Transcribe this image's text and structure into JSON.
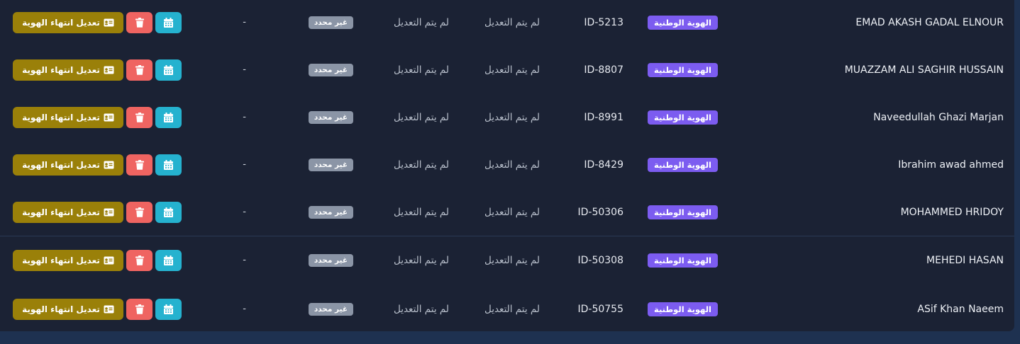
{
  "columns_text": {
    "id_type": "الهوية الوطنية",
    "status_not_modified": "لم يتم التعديل",
    "undefined": "غير محدد",
    "dash": "-",
    "edit_expiry": "تعديل انتهاء الهوية"
  },
  "icons": {
    "edit": "id-card-icon",
    "delete": "trash-icon",
    "calendar": "calendar-icon"
  },
  "colors": {
    "panel_bg": "#1b2234",
    "page_bg": "#1e3150",
    "id_badge": "#7c5cf0",
    "undefined_badge": "#8b95a6",
    "edit_button": "#9a8009",
    "delete_button": "#ef6461",
    "calendar_button": "#25b2cf"
  },
  "rows": [
    {
      "name": "EMAD AKASH GADAL ELNOUR",
      "id_type": "الهوية الوطنية",
      "id_number": "ID-5213",
      "status_a": "لم يتم التعديل",
      "status_b": "لم يتم التعديل",
      "state": "غير محدد",
      "expiry": "-",
      "edit_label": "تعديل انتهاء الهوية"
    },
    {
      "name": "MUAZZAM ALI SAGHIR HUSSAIN",
      "id_type": "الهوية الوطنية",
      "id_number": "ID-8807",
      "status_a": "لم يتم التعديل",
      "status_b": "لم يتم التعديل",
      "state": "غير محدد",
      "expiry": "-",
      "edit_label": "تعديل انتهاء الهوية"
    },
    {
      "name": "Naveedullah Ghazi Marjan",
      "id_type": "الهوية الوطنية",
      "id_number": "ID-8991",
      "status_a": "لم يتم التعديل",
      "status_b": "لم يتم التعديل",
      "state": "غير محدد",
      "expiry": "-",
      "edit_label": "تعديل انتهاء الهوية"
    },
    {
      "name": "Ibrahim awad ahmed",
      "id_type": "الهوية الوطنية",
      "id_number": "ID-8429",
      "status_a": "لم يتم التعديل",
      "status_b": "لم يتم التعديل",
      "state": "غير محدد",
      "expiry": "-",
      "edit_label": "تعديل انتهاء الهوية"
    },
    {
      "name": "MOHAMMED HRIDOY",
      "id_type": "الهوية الوطنية",
      "id_number": "ID-50306",
      "status_a": "لم يتم التعديل",
      "status_b": "لم يتم التعديل",
      "state": "غير محدد",
      "expiry": "-",
      "edit_label": "تعديل انتهاء الهوية"
    },
    {
      "name": "MEHEDI HASAN",
      "id_type": "الهوية الوطنية",
      "id_number": "ID-50308",
      "status_a": "لم يتم التعديل",
      "status_b": "لم يتم التعديل",
      "state": "غير محدد",
      "expiry": "-",
      "edit_label": "تعديل انتهاء الهوية"
    },
    {
      "name": "ASif Khan Naeem",
      "id_type": "الهوية الوطنية",
      "id_number": "ID-50755",
      "status_a": "لم يتم التعديل",
      "status_b": "لم يتم التعديل",
      "state": "غير محدد",
      "expiry": "-",
      "edit_label": "تعديل انتهاء الهوية"
    }
  ]
}
